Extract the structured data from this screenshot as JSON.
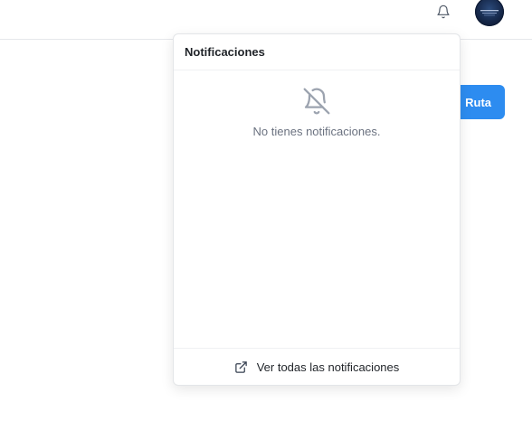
{
  "header": {
    "bell_icon": "bell-icon",
    "avatar_icon": "profile-avatar"
  },
  "page": {
    "route_button_label": "Ruta"
  },
  "notifications": {
    "title": "Notificaciones",
    "empty_icon": "bell-off-icon",
    "empty_message": "No tienes notificaciones.",
    "footer_icon": "external-link-icon",
    "footer_link": "Ver todas las notificaciones"
  },
  "colors": {
    "primary": "#2d8cf0",
    "muted_icon": "#9ca3af",
    "border": "#e3e5e8"
  }
}
